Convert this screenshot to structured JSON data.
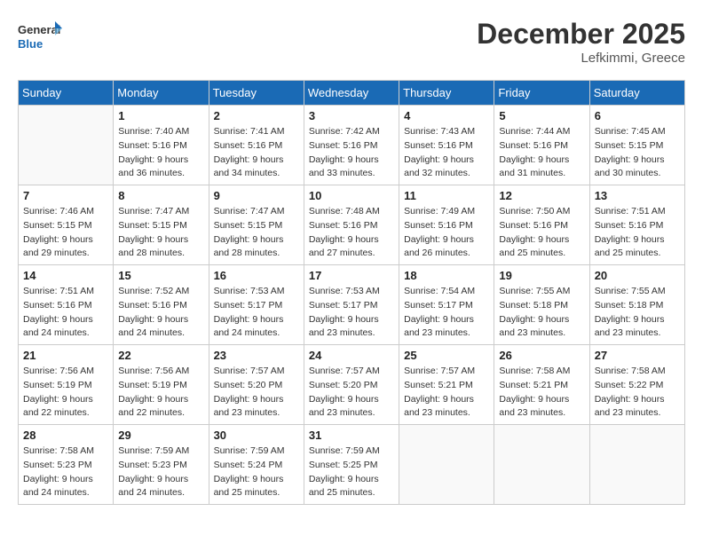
{
  "logo": {
    "line1": "General",
    "line2": "Blue"
  },
  "title": "December 2025",
  "location": "Lefkimmi, Greece",
  "days_of_week": [
    "Sunday",
    "Monday",
    "Tuesday",
    "Wednesday",
    "Thursday",
    "Friday",
    "Saturday"
  ],
  "weeks": [
    [
      {
        "day": "",
        "info": ""
      },
      {
        "day": "1",
        "info": "Sunrise: 7:40 AM\nSunset: 5:16 PM\nDaylight: 9 hours\nand 36 minutes."
      },
      {
        "day": "2",
        "info": "Sunrise: 7:41 AM\nSunset: 5:16 PM\nDaylight: 9 hours\nand 34 minutes."
      },
      {
        "day": "3",
        "info": "Sunrise: 7:42 AM\nSunset: 5:16 PM\nDaylight: 9 hours\nand 33 minutes."
      },
      {
        "day": "4",
        "info": "Sunrise: 7:43 AM\nSunset: 5:16 PM\nDaylight: 9 hours\nand 32 minutes."
      },
      {
        "day": "5",
        "info": "Sunrise: 7:44 AM\nSunset: 5:16 PM\nDaylight: 9 hours\nand 31 minutes."
      },
      {
        "day": "6",
        "info": "Sunrise: 7:45 AM\nSunset: 5:15 PM\nDaylight: 9 hours\nand 30 minutes."
      }
    ],
    [
      {
        "day": "7",
        "info": "Sunrise: 7:46 AM\nSunset: 5:15 PM\nDaylight: 9 hours\nand 29 minutes."
      },
      {
        "day": "8",
        "info": "Sunrise: 7:47 AM\nSunset: 5:15 PM\nDaylight: 9 hours\nand 28 minutes."
      },
      {
        "day": "9",
        "info": "Sunrise: 7:47 AM\nSunset: 5:15 PM\nDaylight: 9 hours\nand 28 minutes."
      },
      {
        "day": "10",
        "info": "Sunrise: 7:48 AM\nSunset: 5:16 PM\nDaylight: 9 hours\nand 27 minutes."
      },
      {
        "day": "11",
        "info": "Sunrise: 7:49 AM\nSunset: 5:16 PM\nDaylight: 9 hours\nand 26 minutes."
      },
      {
        "day": "12",
        "info": "Sunrise: 7:50 AM\nSunset: 5:16 PM\nDaylight: 9 hours\nand 25 minutes."
      },
      {
        "day": "13",
        "info": "Sunrise: 7:51 AM\nSunset: 5:16 PM\nDaylight: 9 hours\nand 25 minutes."
      }
    ],
    [
      {
        "day": "14",
        "info": "Sunrise: 7:51 AM\nSunset: 5:16 PM\nDaylight: 9 hours\nand 24 minutes."
      },
      {
        "day": "15",
        "info": "Sunrise: 7:52 AM\nSunset: 5:16 PM\nDaylight: 9 hours\nand 24 minutes."
      },
      {
        "day": "16",
        "info": "Sunrise: 7:53 AM\nSunset: 5:17 PM\nDaylight: 9 hours\nand 24 minutes."
      },
      {
        "day": "17",
        "info": "Sunrise: 7:53 AM\nSunset: 5:17 PM\nDaylight: 9 hours\nand 23 minutes."
      },
      {
        "day": "18",
        "info": "Sunrise: 7:54 AM\nSunset: 5:17 PM\nDaylight: 9 hours\nand 23 minutes."
      },
      {
        "day": "19",
        "info": "Sunrise: 7:55 AM\nSunset: 5:18 PM\nDaylight: 9 hours\nand 23 minutes."
      },
      {
        "day": "20",
        "info": "Sunrise: 7:55 AM\nSunset: 5:18 PM\nDaylight: 9 hours\nand 23 minutes."
      }
    ],
    [
      {
        "day": "21",
        "info": "Sunrise: 7:56 AM\nSunset: 5:19 PM\nDaylight: 9 hours\nand 22 minutes."
      },
      {
        "day": "22",
        "info": "Sunrise: 7:56 AM\nSunset: 5:19 PM\nDaylight: 9 hours\nand 22 minutes."
      },
      {
        "day": "23",
        "info": "Sunrise: 7:57 AM\nSunset: 5:20 PM\nDaylight: 9 hours\nand 23 minutes."
      },
      {
        "day": "24",
        "info": "Sunrise: 7:57 AM\nSunset: 5:20 PM\nDaylight: 9 hours\nand 23 minutes."
      },
      {
        "day": "25",
        "info": "Sunrise: 7:57 AM\nSunset: 5:21 PM\nDaylight: 9 hours\nand 23 minutes."
      },
      {
        "day": "26",
        "info": "Sunrise: 7:58 AM\nSunset: 5:21 PM\nDaylight: 9 hours\nand 23 minutes."
      },
      {
        "day": "27",
        "info": "Sunrise: 7:58 AM\nSunset: 5:22 PM\nDaylight: 9 hours\nand 23 minutes."
      }
    ],
    [
      {
        "day": "28",
        "info": "Sunrise: 7:58 AM\nSunset: 5:23 PM\nDaylight: 9 hours\nand 24 minutes."
      },
      {
        "day": "29",
        "info": "Sunrise: 7:59 AM\nSunset: 5:23 PM\nDaylight: 9 hours\nand 24 minutes."
      },
      {
        "day": "30",
        "info": "Sunrise: 7:59 AM\nSunset: 5:24 PM\nDaylight: 9 hours\nand 25 minutes."
      },
      {
        "day": "31",
        "info": "Sunrise: 7:59 AM\nSunset: 5:25 PM\nDaylight: 9 hours\nand 25 minutes."
      },
      {
        "day": "",
        "info": ""
      },
      {
        "day": "",
        "info": ""
      },
      {
        "day": "",
        "info": ""
      }
    ]
  ]
}
